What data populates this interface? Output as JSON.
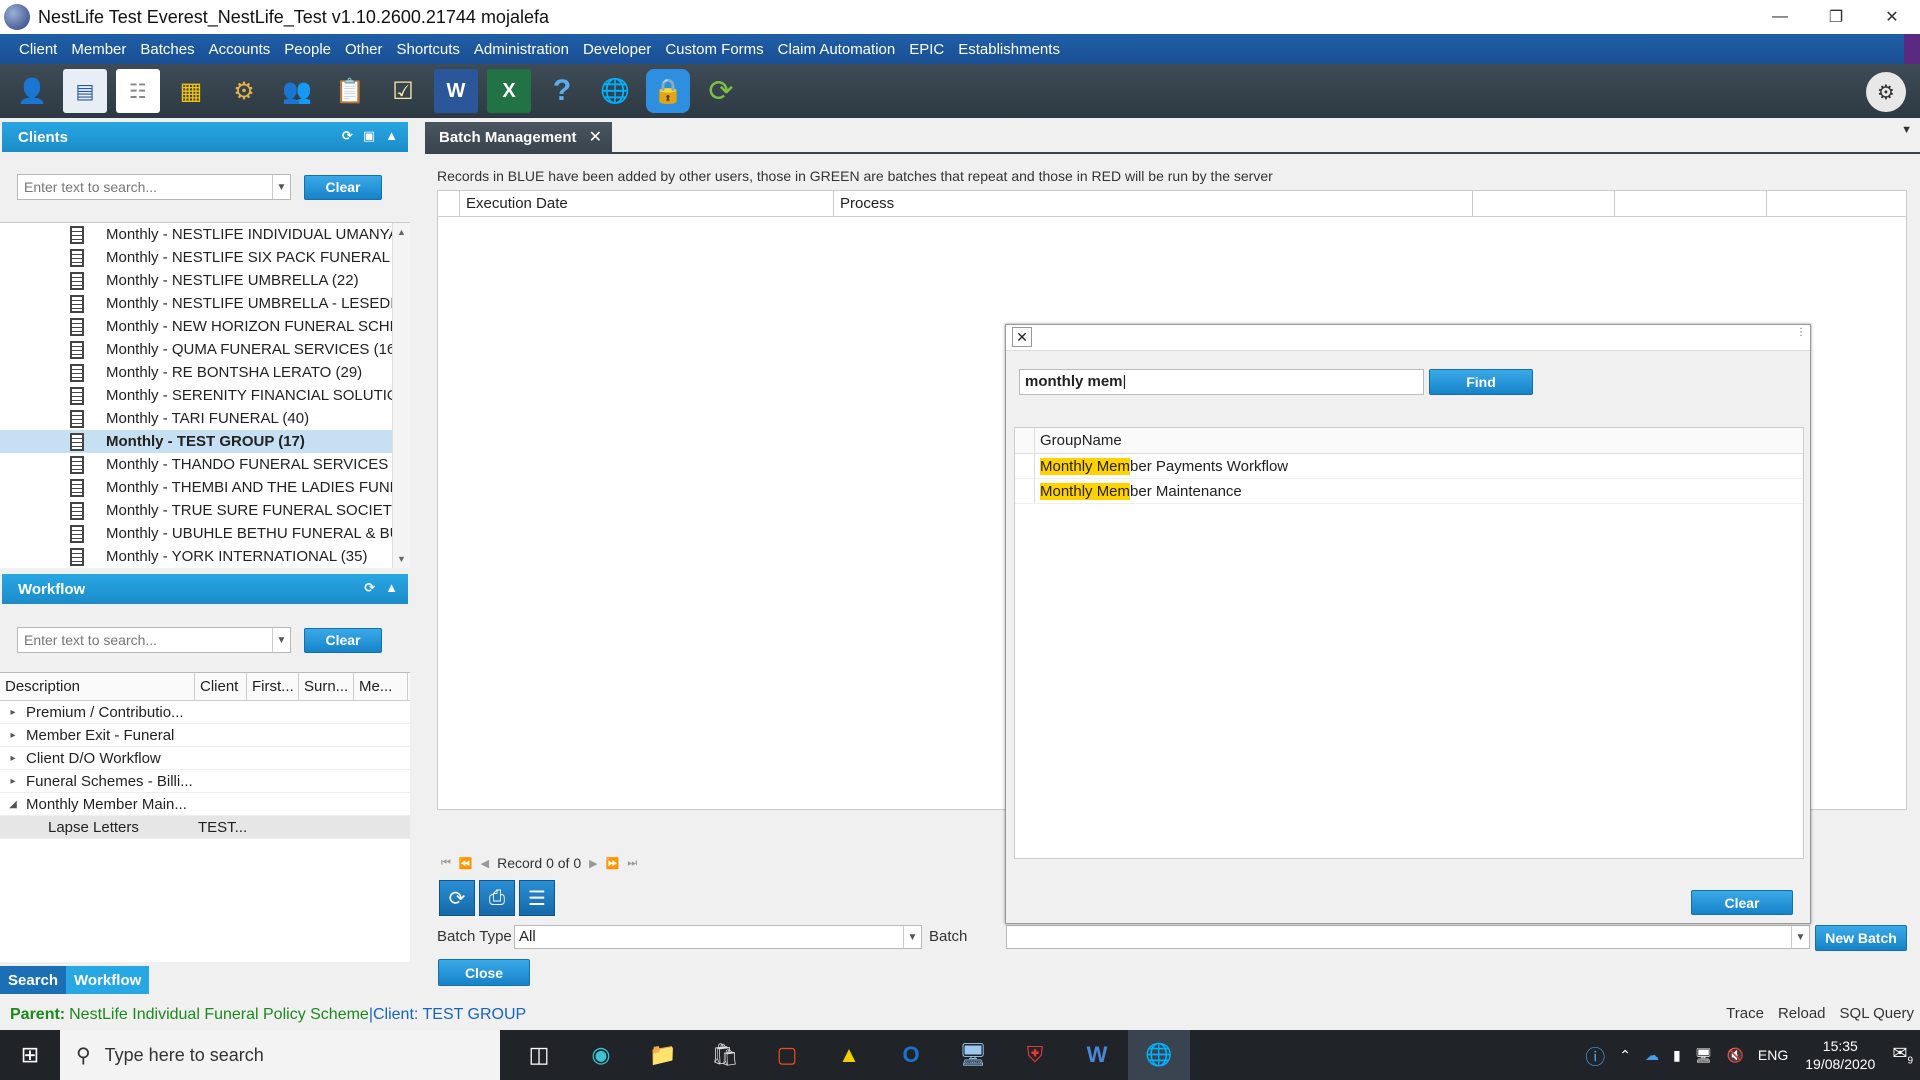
{
  "window": {
    "title": "NestLife Test Everest_NestLife_Test v1.10.2600.21744 mojalefa",
    "controls": [
      "—",
      "❐",
      "✕"
    ]
  },
  "menu": [
    "Client",
    "Member",
    "Batches",
    "Accounts",
    "People",
    "Other",
    "Shortcuts",
    "Administration",
    "Developer",
    "Custom Forms",
    "Claim Automation",
    "EPIC",
    "Establishments"
  ],
  "toolbar": {
    "icons": [
      "user-icon",
      "id-card-icon",
      "document-icon",
      "grid-icon",
      "gears-icon",
      "users-icon",
      "clipboard-edit-icon",
      "clipboard-check-icon",
      "word-icon",
      "excel-icon",
      "help-icon",
      "globe-icon",
      "lock-icon",
      "refresh-icon"
    ]
  },
  "clients": {
    "header": "Clients",
    "search_placeholder": "Enter text to search...",
    "clear_label": "Clear",
    "items": [
      "Monthly - NESTLIFE INDIVIDUAL UMANYA",
      "Monthly - NESTLIFE SIX PACK FUNERAL PL",
      "Monthly - NESTLIFE UMBRELLA (22)",
      "Monthly - NESTLIFE UMBRELLA - LESEDI H",
      "Monthly - NEW HORIZON FUNERAL SCHE",
      "Monthly - QUMA FUNERAL SERVICES (16)",
      "Monthly - RE BONTSHA LERATO (29)",
      "Monthly - SERENITY FINANCIAL SOLUTION",
      "Monthly - TARI FUNERAL (40)",
      "Monthly - TEST GROUP (17)",
      "Monthly - THANDO FUNERAL SERVICES (4",
      "Monthly - THEMBI AND THE LADIES FUNE",
      "Monthly - TRUE SURE FUNERAL SOCIETY (",
      "Monthly - UBUHLE BETHU FUNERAL & BU",
      "Monthly - YORK INTERNATIONAL (35)"
    ],
    "selected_index": 9
  },
  "workflow": {
    "header": "Workflow",
    "search_placeholder": "Enter text to search...",
    "clear_label": "Clear",
    "columns": [
      "Description",
      "Client",
      "First...",
      "Surn...",
      "Me..."
    ],
    "rows": [
      {
        "arrow": "▸",
        "text": "Premium / Contributio..."
      },
      {
        "arrow": "▸",
        "text": "Member Exit - Funeral"
      },
      {
        "arrow": "▸",
        "text": "Client D/O Workflow"
      },
      {
        "arrow": "▸",
        "text": "Funeral Schemes - Billi..."
      },
      {
        "arrow": "◢",
        "text": "Monthly Member Main..."
      }
    ],
    "child": {
      "description": "Lapse Letters",
      "client": "TEST..."
    }
  },
  "bottom_tabs": [
    "Search",
    "Workflow"
  ],
  "batch": {
    "tab_label": "Batch Management",
    "info": "Records in BLUE have been added by other users, those in GREEN are batches that repeat and those in RED will be run by the server",
    "columns": [
      "Execution Date",
      "Process",
      "",
      ""
    ],
    "record_nav": "Record 0 of 0",
    "batch_type_label": "Batch Type",
    "batch_type_value": "All",
    "batch_label": "Batch",
    "new_batch_label": "New Batch",
    "close_label": "Close"
  },
  "find_popup": {
    "query": "monthly mem",
    "find_label": "Find",
    "column": "GroupName",
    "results": [
      {
        "match": "Monthly Mem",
        "rest": "ber Payments Workflow"
      },
      {
        "match": "Monthly Mem",
        "rest": "ber Maintenance"
      }
    ],
    "clear_label": "Clear"
  },
  "status": {
    "parent_label": "Parent:",
    "parent_value": "NestLife Individual Funeral Policy Scheme",
    "client_text": "|Client: TEST GROUP",
    "right": [
      "Trace",
      "Reload",
      "SQL Query"
    ]
  },
  "taskbar": {
    "search_placeholder": "Type here to search",
    "lang": "ENG",
    "time": "15:35",
    "date": "19/08/2020",
    "notif_count": "9"
  },
  "colors": {
    "menubar": "#1f5fa8",
    "panel_header": "#27a7e3",
    "highlight": "#ffd200",
    "status_parent": "#1a8a1a",
    "status_client": "#1565c0"
  }
}
